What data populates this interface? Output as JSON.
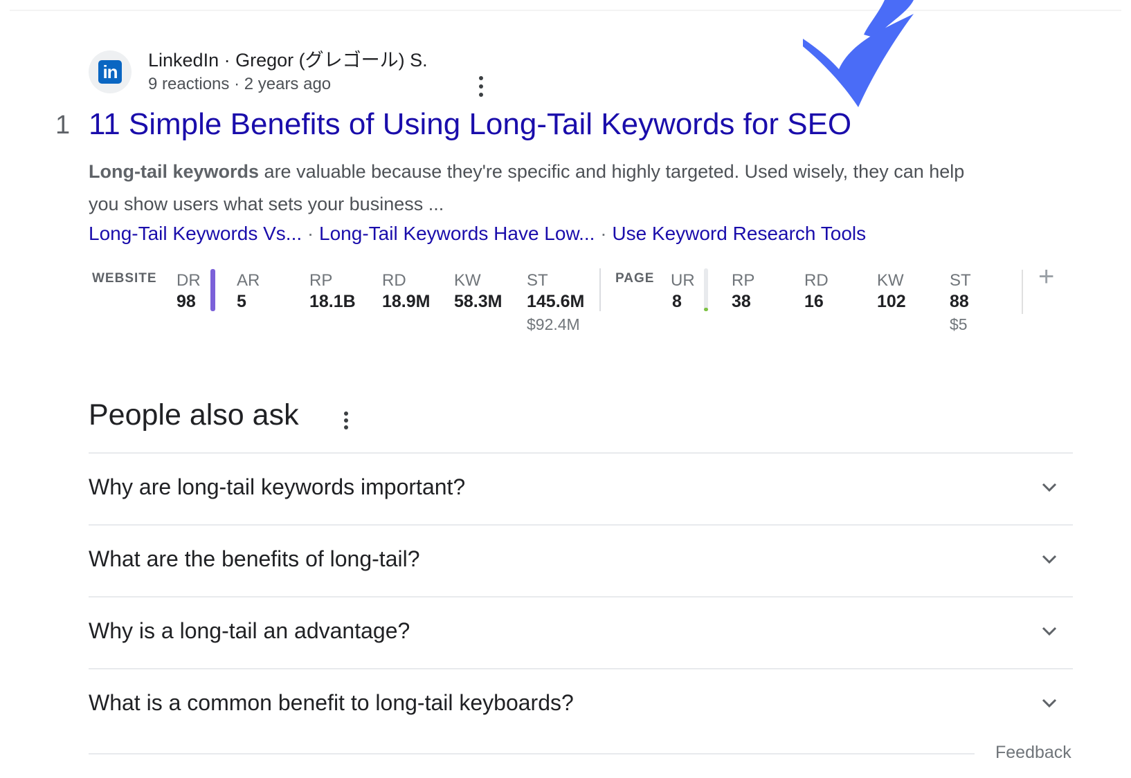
{
  "annotation": {
    "arrow_color": "#4a6cf7",
    "icon": "down-arrow-annotation"
  },
  "result": {
    "source_icon": "linkedin-icon",
    "source_icon_text": "in",
    "source_name": "LinkedIn · Gregor (グレゴール) S.",
    "source_meta": "9 reactions · 2 years ago",
    "rank": "1",
    "title": "11 Simple Benefits of Using Long-Tail Keywords for SEO",
    "snippet_bold": "Long-tail keywords",
    "snippet_rest": " are valuable because they're specific and highly targeted. Used wisely, they can help you show users what sets your business ...",
    "sitelinks": [
      "Long-Tail Keywords Vs...",
      "Long-Tail Keywords Have Low...",
      "Use Keyword Research Tools"
    ],
    "sitelink_separator": " · "
  },
  "metrics": {
    "website_label": "WEBSITE",
    "page_label": "PAGE",
    "website": {
      "DR": {
        "label": "DR",
        "value": "98"
      },
      "AR": {
        "label": "AR",
        "value": "5"
      },
      "RP": {
        "label": "RP",
        "value": "18.1B"
      },
      "RD": {
        "label": "RD",
        "value": "18.9M"
      },
      "KW": {
        "label": "KW",
        "value": "58.3M"
      },
      "ST": {
        "label": "ST",
        "value": "145.6M",
        "sub": "$92.4M"
      }
    },
    "page": {
      "UR": {
        "label": "UR",
        "value": "8"
      },
      "RP": {
        "label": "RP",
        "value": "38"
      },
      "RD": {
        "label": "RD",
        "value": "16"
      },
      "KW": {
        "label": "KW",
        "value": "102"
      },
      "ST": {
        "label": "ST",
        "value": "88",
        "sub": "$5"
      }
    },
    "dr_bar_level": 0.98,
    "ur_bar_level": 0.08,
    "dr_bar_color": "#7b61d9",
    "ur_bar_color": "#7cc142",
    "add_label": "+"
  },
  "paa": {
    "title": "People also ask",
    "questions": [
      "Why are long-tail keywords important?",
      "What are the benefits of long-tail?",
      "Why is a long-tail an advantage?",
      "What is a common benefit to long-tail keyboards?"
    ],
    "feedback": "Feedback"
  }
}
